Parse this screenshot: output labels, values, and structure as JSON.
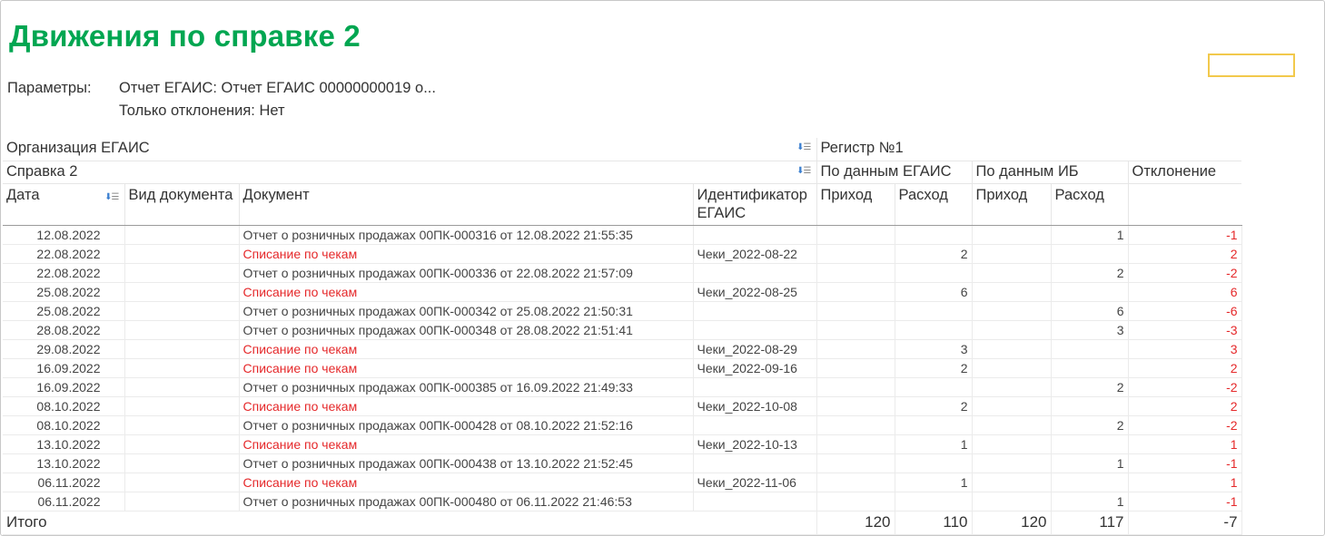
{
  "title": "Движения по справке 2",
  "params": [
    {
      "label": "Параметры:",
      "value": "Отчет ЕГАИС: Отчет ЕГАИС 00000000019 о..."
    },
    {
      "label": "",
      "value": "Только отклонения: Нет"
    }
  ],
  "header": {
    "org": "Организация ЕГАИС",
    "register": "Регистр №1",
    "certificate": "Справка 2",
    "egais_data": "По данным ЕГАИС",
    "ib_data": "По данным ИБ",
    "deviation": "Отклонение",
    "col_date": "Дата",
    "col_doc_type": "Вид документа",
    "col_document": "Документ",
    "col_identifier": "Идентификатор ЕГАИС",
    "col_in_egais": "Приход",
    "col_out_egais": "Расход",
    "col_in_ib": "Приход",
    "col_out_ib": "Расход"
  },
  "rows": [
    {
      "date": "12.08.2022",
      "type": "",
      "doc": "Отчет о розничных продажах 00ПК-000316 от 12.08.2022 21:55:35",
      "red": false,
      "id": "",
      "in_egais": "",
      "out_egais": "",
      "in_ib": "",
      "out_ib": "1",
      "dev": "-1"
    },
    {
      "date": "22.08.2022",
      "type": "",
      "doc": "Списание по чекам",
      "red": true,
      "id": "Чеки_2022-08-22",
      "in_egais": "",
      "out_egais": "2",
      "in_ib": "",
      "out_ib": "",
      "dev": "2"
    },
    {
      "date": "22.08.2022",
      "type": "",
      "doc": "Отчет о розничных продажах 00ПК-000336 от 22.08.2022 21:57:09",
      "red": false,
      "id": "",
      "in_egais": "",
      "out_egais": "",
      "in_ib": "",
      "out_ib": "2",
      "dev": "-2"
    },
    {
      "date": "25.08.2022",
      "type": "",
      "doc": "Списание по чекам",
      "red": true,
      "id": "Чеки_2022-08-25",
      "in_egais": "",
      "out_egais": "6",
      "in_ib": "",
      "out_ib": "",
      "dev": "6"
    },
    {
      "date": "25.08.2022",
      "type": "",
      "doc": "Отчет о розничных продажах 00ПК-000342 от 25.08.2022 21:50:31",
      "red": false,
      "id": "",
      "in_egais": "",
      "out_egais": "",
      "in_ib": "",
      "out_ib": "6",
      "dev": "-6"
    },
    {
      "date": "28.08.2022",
      "type": "",
      "doc": "Отчет о розничных продажах 00ПК-000348 от 28.08.2022 21:51:41",
      "red": false,
      "id": "",
      "in_egais": "",
      "out_egais": "",
      "in_ib": "",
      "out_ib": "3",
      "dev": "-3"
    },
    {
      "date": "29.08.2022",
      "type": "",
      "doc": "Списание по чекам",
      "red": true,
      "id": "Чеки_2022-08-29",
      "in_egais": "",
      "out_egais": "3",
      "in_ib": "",
      "out_ib": "",
      "dev": "3"
    },
    {
      "date": "16.09.2022",
      "type": "",
      "doc": "Списание по чекам",
      "red": true,
      "id": "Чеки_2022-09-16",
      "in_egais": "",
      "out_egais": "2",
      "in_ib": "",
      "out_ib": "",
      "dev": "2"
    },
    {
      "date": "16.09.2022",
      "type": "",
      "doc": "Отчет о розничных продажах 00ПК-000385 от 16.09.2022 21:49:33",
      "red": false,
      "id": "",
      "in_egais": "",
      "out_egais": "",
      "in_ib": "",
      "out_ib": "2",
      "dev": "-2"
    },
    {
      "date": "08.10.2022",
      "type": "",
      "doc": "Списание по чекам",
      "red": true,
      "id": "Чеки_2022-10-08",
      "in_egais": "",
      "out_egais": "2",
      "in_ib": "",
      "out_ib": "",
      "dev": "2"
    },
    {
      "date": "08.10.2022",
      "type": "",
      "doc": "Отчет о розничных продажах 00ПК-000428 от 08.10.2022 21:52:16",
      "red": false,
      "id": "",
      "in_egais": "",
      "out_egais": "",
      "in_ib": "",
      "out_ib": "2",
      "dev": "-2"
    },
    {
      "date": "13.10.2022",
      "type": "",
      "doc": "Списание по чекам",
      "red": true,
      "id": "Чеки_2022-10-13",
      "in_egais": "",
      "out_egais": "1",
      "in_ib": "",
      "out_ib": "",
      "dev": "1"
    },
    {
      "date": "13.10.2022",
      "type": "",
      "doc": "Отчет о розничных продажах 00ПК-000438 от 13.10.2022 21:52:45",
      "red": false,
      "id": "",
      "in_egais": "",
      "out_egais": "",
      "in_ib": "",
      "out_ib": "1",
      "dev": "-1"
    },
    {
      "date": "06.11.2022",
      "type": "",
      "doc": "Списание по чекам",
      "red": true,
      "id": "Чеки_2022-11-06",
      "in_egais": "",
      "out_egais": "1",
      "in_ib": "",
      "out_ib": "",
      "dev": "1"
    },
    {
      "date": "06.11.2022",
      "type": "",
      "doc": "Отчет о розничных продажах 00ПК-000480 от 06.11.2022 21:46:53",
      "red": false,
      "id": "",
      "in_egais": "",
      "out_egais": "",
      "in_ib": "",
      "out_ib": "1",
      "dev": "-1"
    }
  ],
  "total": {
    "label": "Итого",
    "in_egais": "120",
    "out_egais": "110",
    "in_ib": "120",
    "out_ib": "117",
    "dev": "-7"
  },
  "colors": {
    "title": "#00a651",
    "negative": "#e5282a",
    "sort_icon": "#3b7fd0",
    "highlight_border": "#f2c94c"
  },
  "icons": {
    "sort": "sort-icon"
  }
}
